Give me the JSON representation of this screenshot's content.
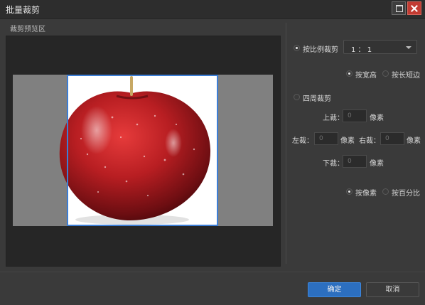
{
  "window": {
    "title": "批量裁剪"
  },
  "preview": {
    "label": "裁剪预览区"
  },
  "options": {
    "by_ratio": {
      "label": "按比例裁剪",
      "selected": true
    },
    "ratio_select": {
      "value": "1 ： 1"
    },
    "by_width_height": {
      "label": "按宽高",
      "selected": true
    },
    "by_long_short": {
      "label": "按长短边",
      "selected": false
    },
    "four_sides": {
      "label": "四周裁剪",
      "selected": false
    },
    "top": {
      "label": "上裁：",
      "placeholder": "0",
      "unit": "像素"
    },
    "left": {
      "label": "左裁：",
      "placeholder": "0",
      "unit": "像素"
    },
    "right": {
      "label": "右裁：",
      "placeholder": "0",
      "unit": "像素"
    },
    "bottom": {
      "label": "下裁：",
      "placeholder": "0",
      "unit": "像素"
    },
    "by_pixel": {
      "label": "按像素",
      "selected": true
    },
    "by_percent": {
      "label": "按百分比",
      "selected": false
    }
  },
  "footer": {
    "ok_label": "确定",
    "cancel_label": "取消"
  },
  "colors": {
    "accent": "#2c6fc0",
    "crop_frame": "#3c7ed6",
    "close": "#c23b32"
  }
}
